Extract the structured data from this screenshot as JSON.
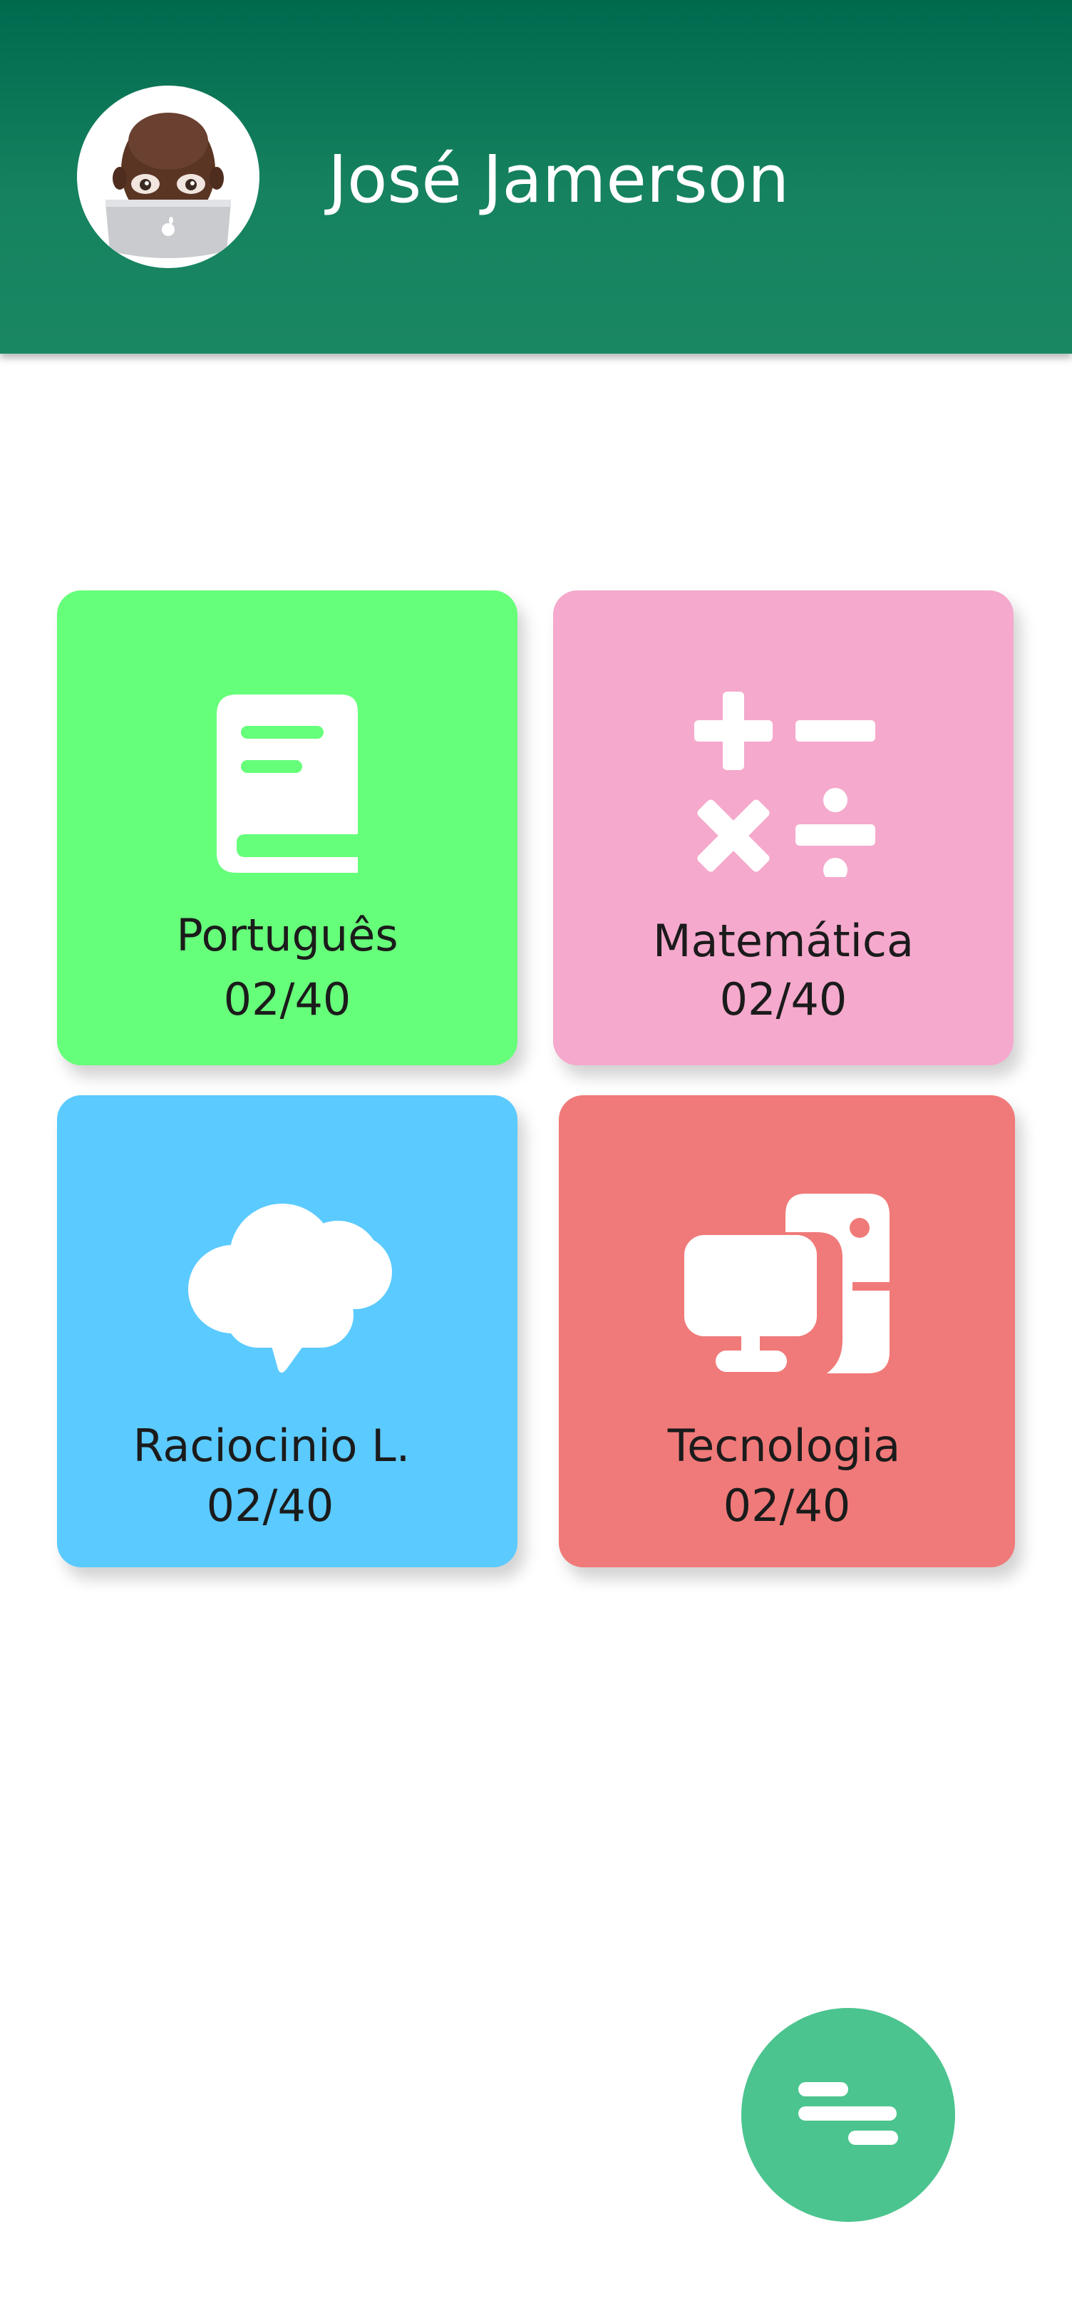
{
  "header": {
    "user_name": "José Jamerson"
  },
  "subjects": [
    {
      "label": "Português",
      "score": "02/40",
      "icon": "book-icon",
      "color": "#66ff7a"
    },
    {
      "label": "Matemática",
      "score": "02/40",
      "icon": "math-operations-icon",
      "color": "#f5a9cc"
    },
    {
      "label": "Raciocinio L.",
      "score": "02/40",
      "icon": "brain-icon",
      "color": "#5bcaff"
    },
    {
      "label": "Tecnologia",
      "score": "02/40",
      "icon": "computer-icon",
      "color": "#f07a79"
    }
  ],
  "fab": {
    "icon": "filter-menu-icon",
    "color": "#4bc48f"
  },
  "theme": {
    "header_color": "#0f7a57"
  }
}
